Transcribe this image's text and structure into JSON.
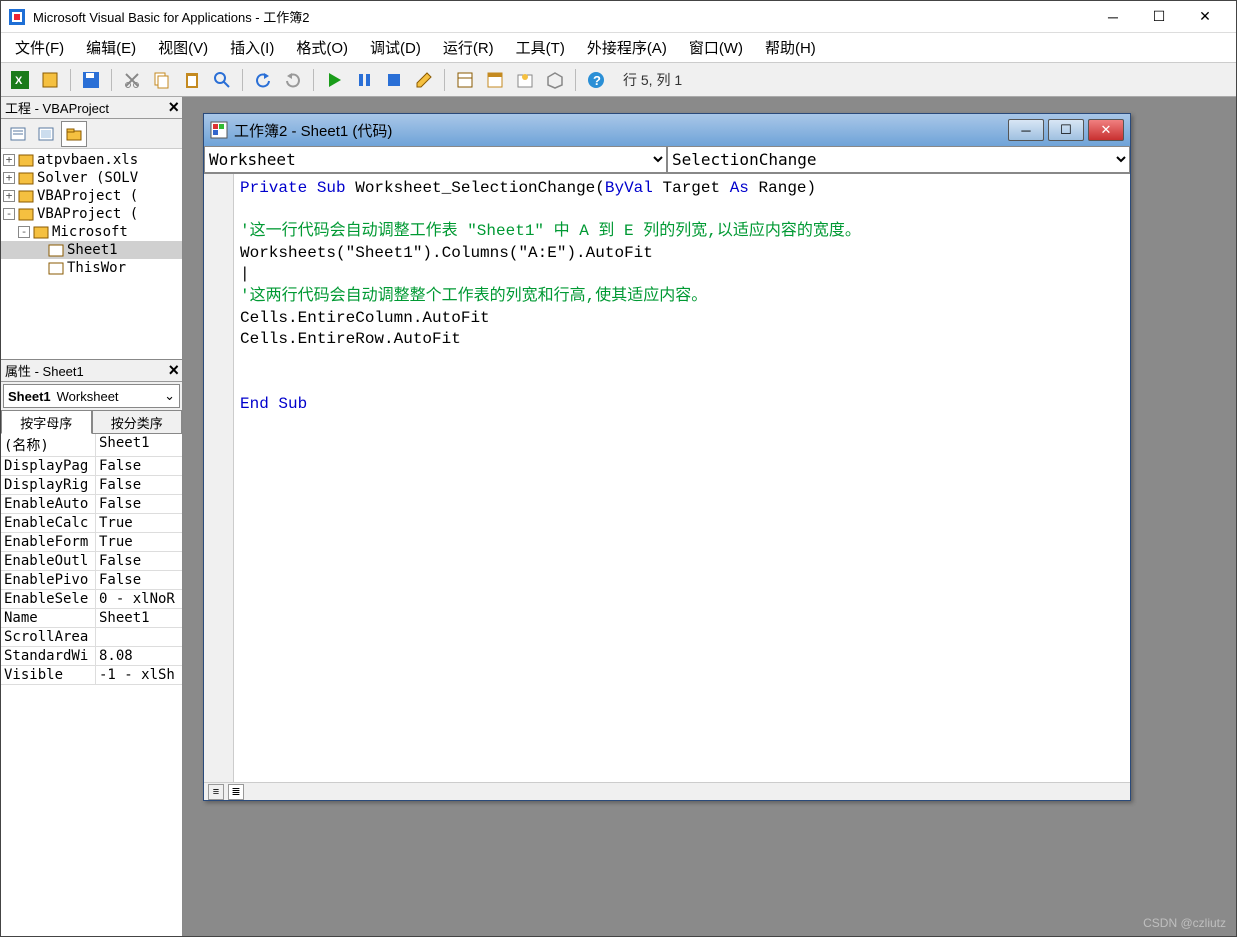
{
  "title": "Microsoft Visual Basic for Applications - 工作簿2",
  "menu": {
    "file": "文件(F)",
    "edit": "编辑(E)",
    "view": "视图(V)",
    "insert": "插入(I)",
    "format": "格式(O)",
    "debug": "调试(D)",
    "run": "运行(R)",
    "tools": "工具(T)",
    "addins": "外接程序(A)",
    "window": "窗口(W)",
    "help": "帮助(H)"
  },
  "toolbar": {
    "status": "行 5, 列 1"
  },
  "project": {
    "title": "工程 - VBAProject",
    "items": [
      {
        "expand": "+",
        "label": "atpvbaen.xls"
      },
      {
        "expand": "+",
        "label": "Solver (SOLV"
      },
      {
        "expand": "+",
        "label": "VBAProject ("
      },
      {
        "expand": "-",
        "label": "VBAProject ("
      },
      {
        "expand": "-",
        "indent": 1,
        "label": "Microsoft"
      },
      {
        "indent": 2,
        "label": "Sheet1",
        "hl": true
      },
      {
        "indent": 2,
        "label": "ThisWor"
      }
    ]
  },
  "properties": {
    "title": "属性 - Sheet1",
    "combo_bold": "Sheet1",
    "combo_rest": "Worksheet",
    "tab_alpha": "按字母序",
    "tab_category": "按分类序",
    "rows": [
      {
        "n": "(名称)",
        "v": "Sheet1"
      },
      {
        "n": "DisplayPag",
        "v": "False"
      },
      {
        "n": "DisplayRig",
        "v": "False"
      },
      {
        "n": "EnableAuto",
        "v": "False"
      },
      {
        "n": "EnableCalc",
        "v": "True"
      },
      {
        "n": "EnableForm",
        "v": "True"
      },
      {
        "n": "EnableOutl",
        "v": "False"
      },
      {
        "n": "EnablePivo",
        "v": "False"
      },
      {
        "n": "EnableSele",
        "v": "0 - xlNoR"
      },
      {
        "n": "Name",
        "v": "Sheet1"
      },
      {
        "n": "ScrollArea",
        "v": ""
      },
      {
        "n": "StandardWi",
        "v": "8.08"
      },
      {
        "n": "Visible",
        "v": "-1 - xlSh"
      }
    ]
  },
  "code_window": {
    "title": "工作簿2 - Sheet1 (代码)",
    "object_dropdown": "Worksheet",
    "proc_dropdown": "SelectionChange",
    "line1_a": "Private Sub",
    "line1_b": " Worksheet_SelectionChange(",
    "line1_c": "ByVal",
    "line1_d": " Target ",
    "line1_e": "As",
    "line1_f": " Range)",
    "comment1": "'这一行代码会自动调整工作表 \"Sheet1\" 中 A 到 E 列的列宽,以适应内容的宽度。",
    "line2": "Worksheets(\"Sheet1\").Columns(\"A:E\").AutoFit",
    "comment2": "'这两行代码会自动调整整个工作表的列宽和行高,使其适应内容。",
    "line3": "Cells.EntireColumn.AutoFit",
    "line4": "Cells.EntireRow.AutoFit",
    "endsub": "End Sub"
  },
  "watermark": "CSDN @czliutz"
}
